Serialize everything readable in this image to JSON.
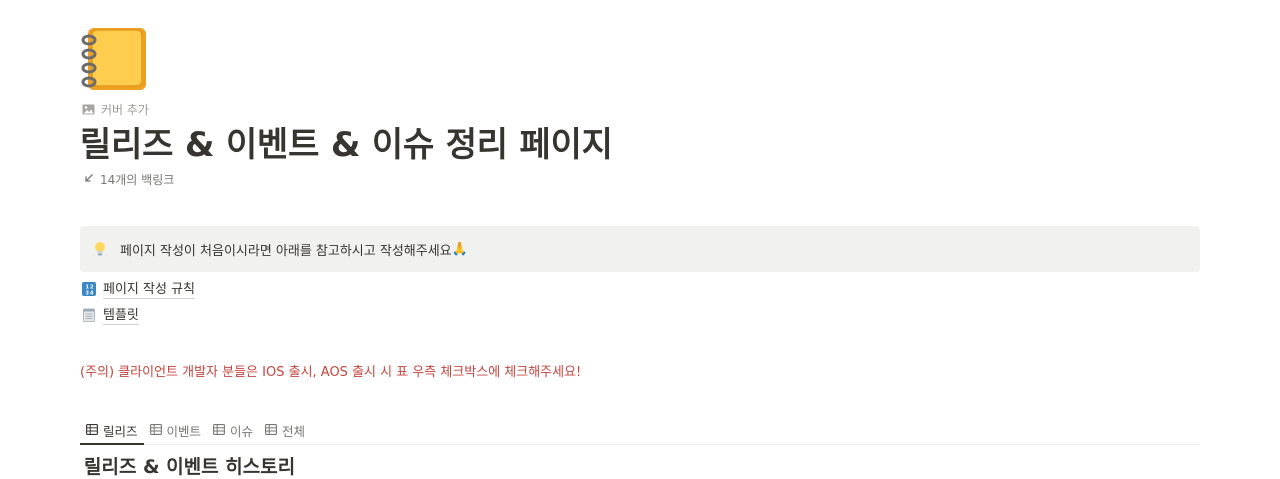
{
  "page": {
    "icon": "notebook-icon",
    "add_cover_label": "커버 추가",
    "title": "릴리즈 & 이벤트 & 이슈 정리 페이지",
    "backlinks_label": "14개의 백링크"
  },
  "callout": {
    "icon": "lightbulb-icon",
    "text": "페이지 작성이 처음이시라면 아래를 참고하시고 작성해주세요",
    "emoji": "🙏"
  },
  "links": [
    {
      "icon": "numbers-icon",
      "label": "페이지 작성 규칙"
    },
    {
      "icon": "notepad-icon",
      "label": "템플릿"
    }
  ],
  "warning": {
    "text": "(주의) 클라이언트 개발자 분들은 IOS 출시, AOS 출시 시 표 우측 체크박스에 체크해주세요!",
    "color": "#c4463f"
  },
  "tabs": [
    {
      "label": "릴리즈",
      "icon": "table-icon",
      "active": true
    },
    {
      "label": "이벤트",
      "icon": "table-icon",
      "active": false
    },
    {
      "label": "이슈",
      "icon": "table-icon",
      "active": false
    },
    {
      "label": "전체",
      "icon": "table-icon",
      "active": false
    }
  ],
  "database": {
    "title": "릴리즈 & 이벤트 히스토리"
  }
}
